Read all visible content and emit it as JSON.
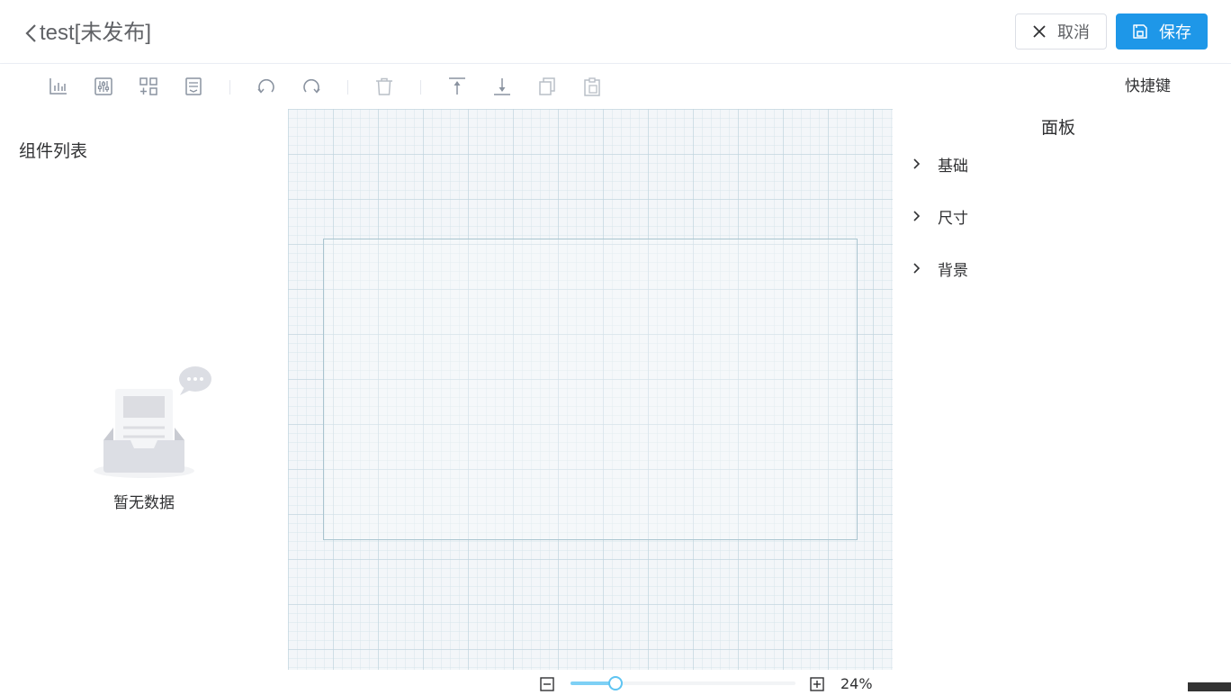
{
  "header": {
    "title": "test[未发布]",
    "cancel_label": "取消",
    "save_label": "保存"
  },
  "toolbar": {
    "tools": [
      "chart-icon",
      "sliders-icon",
      "add-grid-icon",
      "form-icon",
      "undo-icon",
      "redo-icon",
      "delete-icon",
      "move-top-icon",
      "move-bottom-icon",
      "copy-icon",
      "paste-icon"
    ],
    "shortcut_label": "快捷键"
  },
  "left_panel": {
    "title": "组件列表",
    "empty_text": "暂无数据"
  },
  "zoom": {
    "percent_label": "24%",
    "value": 0.2
  },
  "right_panel": {
    "title": "面板",
    "sections": [
      {
        "label": "基础"
      },
      {
        "label": "尺寸"
      },
      {
        "label": "背景"
      }
    ]
  },
  "colors": {
    "primary": "#1e97e8",
    "slider": "#7ed0f5",
    "text": "#303133",
    "muted": "#606266",
    "icon": "#8a93a0"
  }
}
